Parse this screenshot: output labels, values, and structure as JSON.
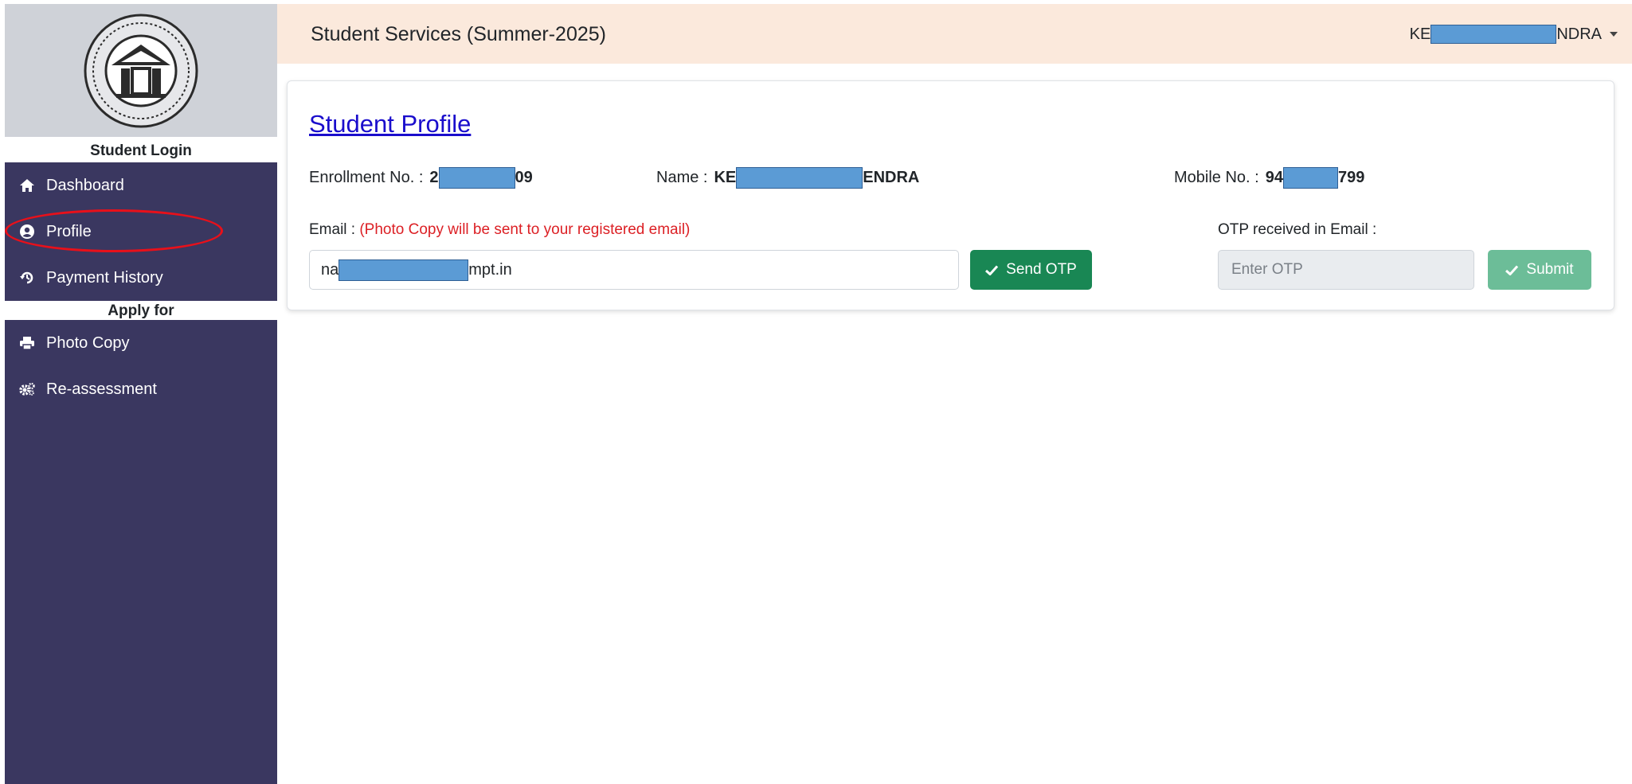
{
  "header": {
    "title": "Student Services (Summer-2025)",
    "user_prefix": "KE",
    "user_suffix": "NDRA"
  },
  "sidebar": {
    "section_login": "Student Login",
    "items": [
      {
        "label": "Dashboard",
        "icon": "home-icon"
      },
      {
        "label": "Profile",
        "icon": "user-circle-icon",
        "highlighted": true
      },
      {
        "label": "Payment History",
        "icon": "history-icon"
      }
    ],
    "section_apply": "Apply for",
    "apply_items": [
      {
        "label": "Photo Copy",
        "icon": "print-icon"
      },
      {
        "label": "Re-assessment",
        "icon": "gears-icon"
      }
    ]
  },
  "profile": {
    "title": "Student Profile",
    "enrollment_label": "Enrollment No. :",
    "enrollment_prefix": "2",
    "enrollment_suffix": "09",
    "name_label": "Name :",
    "name_prefix": "KE",
    "name_suffix": "ENDRA",
    "mobile_label": "Mobile No. :",
    "mobile_prefix": "94",
    "mobile_suffix": "799",
    "email_label": "Email :",
    "email_note": "(Photo Copy will be sent to your registered email)",
    "email_prefix": "na",
    "email_suffix": "mpt.in",
    "otp_label": "OTP received in Email :",
    "otp_placeholder": "Enter OTP",
    "send_otp_label": "Send OTP",
    "submit_label": "Submit"
  },
  "colors": {
    "sidebar_bg": "#3a3760",
    "header_bg": "#fbe9dc",
    "link": "#1a0dcc",
    "note_red": "#dc2025",
    "send_btn": "#198754",
    "submit_btn": "#6cbd98",
    "redaction": "#5b9bd5",
    "highlight_ring": "#e8101a"
  }
}
